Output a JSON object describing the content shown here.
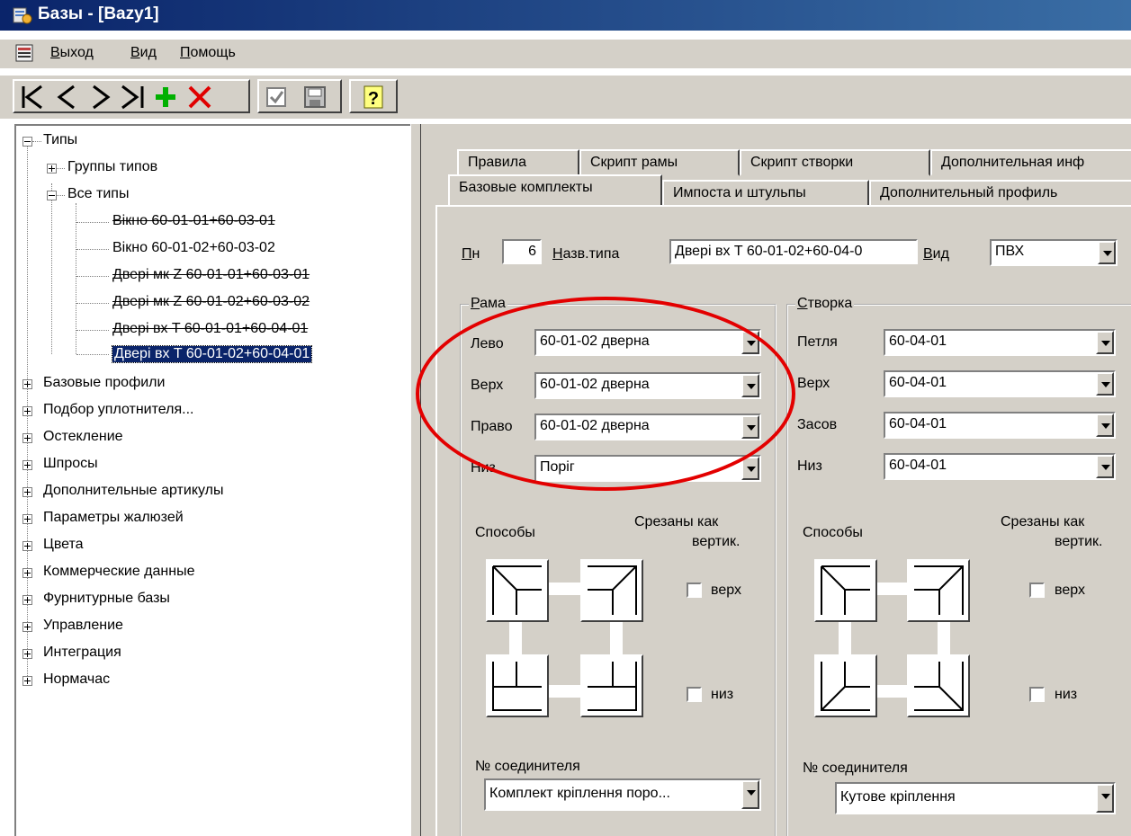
{
  "window": {
    "title": "Базы - [Bazy1]"
  },
  "menu": {
    "items": [
      "Выход",
      "Вид",
      "Помощь"
    ]
  },
  "tree": {
    "root": "Типы",
    "groups": "Группы типов",
    "all": "Все типы",
    "types": [
      "Вікно 60-01-01+60-03-01",
      "Вікно 60-01-02+60-03-02",
      "Двері мк Z 60-01-01+60-03-01",
      "Двері мк Z 60-01-02+60-03-02",
      "Двері вх T 60-01-01+60-04-01",
      "Двері вх T 60-01-02+60-04-01"
    ],
    "sections": [
      "Базовые профили",
      "Подбор уплотнителя...",
      "Остекление",
      "Шпросы",
      "Дополнительные артикулы",
      "Параметры жалюзей",
      "Цвета",
      "Коммерческие данные",
      "Фурнитурные базы",
      "Управление",
      "Интеграция",
      "Нормачас"
    ]
  },
  "tabs": {
    "row1": [
      "Правила",
      "Скрипт рамы",
      "Скрипт створки",
      "Дополнительная инф"
    ],
    "row2": [
      "Базовые комплекты",
      "Импоста и штульпы",
      "Дополнительный профиль"
    ]
  },
  "form": {
    "pn_label": "Пн",
    "pn_value": "6",
    "name_label": "Назв.типа",
    "name_value": "Двері вх T 60-01-02+60-04-0",
    "view_label": "Вид",
    "view_value": "ПВХ"
  },
  "frame": {
    "title": "Рама",
    "rows": [
      {
        "label": "Лево",
        "value": "60-01-02 дверна"
      },
      {
        "label": "Верх",
        "value": "60-01-02 дверна"
      },
      {
        "label": "Право",
        "value": "60-01-02 дверна"
      },
      {
        "label": "Низ",
        "value": "Поріг"
      }
    ],
    "methods": "Способы",
    "cut_title": "Срезаны как",
    "cut_title2": "вертик.",
    "chk_top": "верх",
    "chk_bottom": "низ",
    "conn_label": "№ соединителя",
    "conn_value": "Комплект кріплення поро..."
  },
  "sash": {
    "title": "Створка",
    "rows": [
      {
        "label": "Петля",
        "value": "60-04-01"
      },
      {
        "label": "Верх",
        "value": "60-04-01"
      },
      {
        "label": "Засов",
        "value": "60-04-01"
      },
      {
        "label": "Низ",
        "value": "60-04-01"
      }
    ],
    "methods": "Способы",
    "cut_title": "Срезаны как",
    "cut_title2": "вертик.",
    "chk_top": "верх",
    "chk_bottom": "низ",
    "conn_label": "№ соединителя",
    "conn_value": "Кутове кріплення"
  },
  "colors": {
    "selection": "#0a246a",
    "annotation": "#e30000",
    "add": "#00b000",
    "delete": "#e00000"
  }
}
